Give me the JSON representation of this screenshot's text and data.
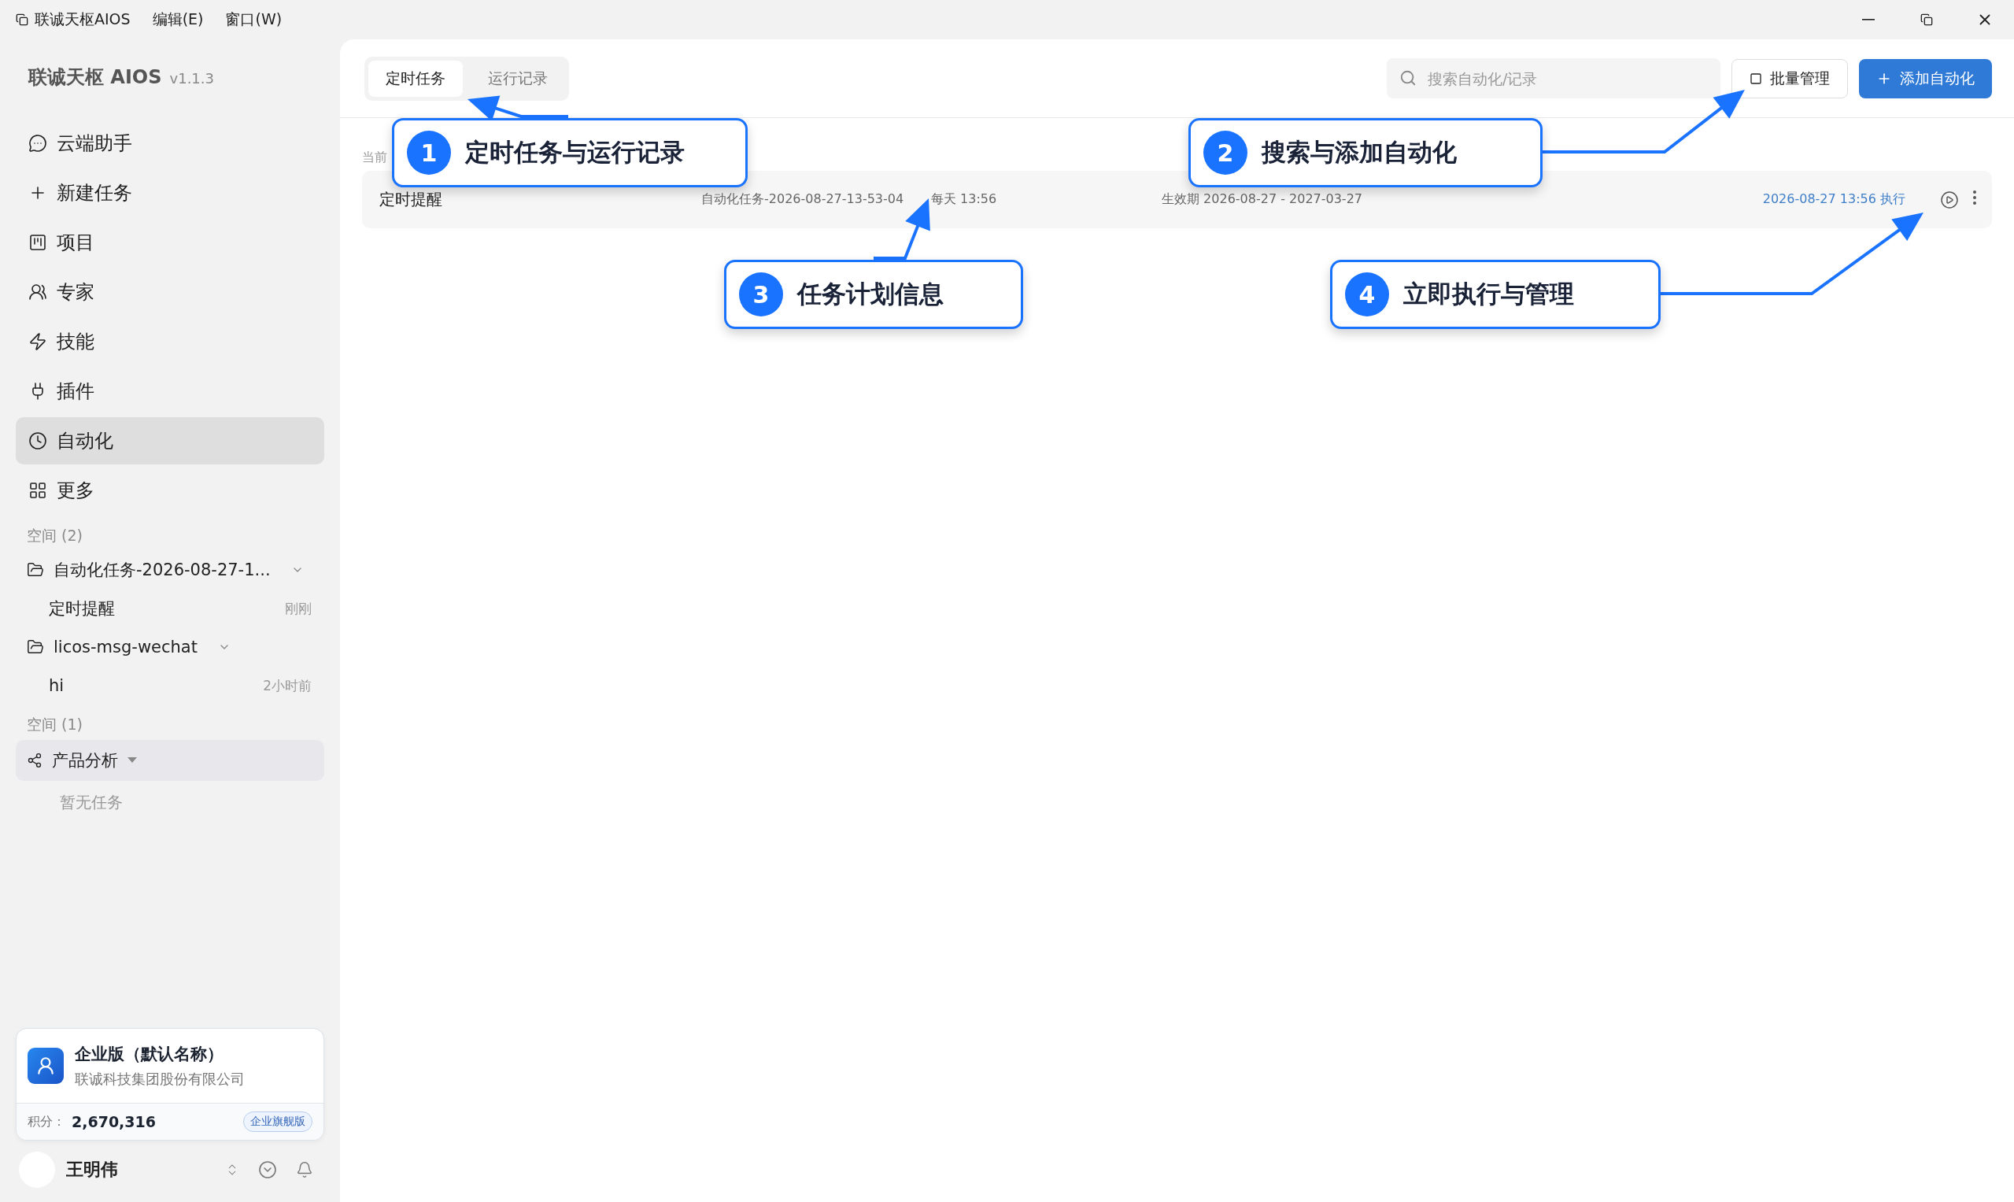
{
  "menu_bar": {
    "app_name": "联诚天枢AIOS",
    "menus": [
      "编辑(E)",
      "窗口(W)"
    ]
  },
  "sidebar": {
    "brand": "联诚天枢 AIOS",
    "version": "v1.1.3",
    "nav": [
      {
        "label": "云端助手",
        "kind": "chat",
        "selected": false
      },
      {
        "label": "新建任务",
        "kind": "plus",
        "selected": false
      },
      {
        "label": "项目",
        "kind": "kanban",
        "selected": false
      },
      {
        "label": "专家",
        "kind": "experts",
        "selected": false
      },
      {
        "label": "技能",
        "kind": "bolt",
        "selected": false
      },
      {
        "label": "插件",
        "kind": "plug",
        "selected": false
      },
      {
        "label": "自动化",
        "kind": "clock",
        "selected": true
      },
      {
        "label": "更多",
        "kind": "grid",
        "selected": false
      }
    ],
    "spaces": [
      {
        "title": "空间 (2)",
        "groups": [
          {
            "kind": "folder",
            "name": "自动化任务-2026-08-27-1...",
            "items": [
              {
                "name": "定时提醒",
                "time": "刚刚"
              }
            ]
          },
          {
            "kind": "folder",
            "name": "licos-msg-wechat",
            "items": [
              {
                "name": "hi",
                "time": "2小时前"
              }
            ]
          }
        ]
      },
      {
        "title": "空间 (1)",
        "groups": [
          {
            "kind": "shared",
            "name": "产品分析",
            "empty": "暂无任务"
          }
        ]
      }
    ],
    "org_card": {
      "name": "企业版（默认名称）",
      "company": "联诚科技集团股份有限公司",
      "points_label": "积分：",
      "points": "2,670,316",
      "badge": "企业旗舰版"
    },
    "user": {
      "name": "王明伟"
    }
  },
  "main": {
    "tabs": [
      {
        "label": "定时任务",
        "selected": true
      },
      {
        "label": "运行记录",
        "selected": false
      }
    ],
    "search": {
      "placeholder": "搜索自动化/记录"
    },
    "buttons": [
      {
        "label": "批量管理",
        "kind": "outline"
      },
      {
        "label": "添加自动化",
        "kind": "primary"
      }
    ],
    "section_label": "当前",
    "tasks": [
      {
        "name": "定时提醒",
        "project": "自动化任务-2026-08-27-13-53-04",
        "schedule": "每天 13:56",
        "validity": "生效期 2026-08-27 - 2027-03-27",
        "next_run": "2026-08-27 13:56 执行"
      }
    ]
  },
  "callouts": [
    {
      "number": "1",
      "text": "定时任务与运行记录"
    },
    {
      "number": "2",
      "text": "搜索与添加自动化"
    },
    {
      "number": "3",
      "text": "任务计划信息"
    },
    {
      "number": "4",
      "text": "立即执行与管理"
    }
  ]
}
